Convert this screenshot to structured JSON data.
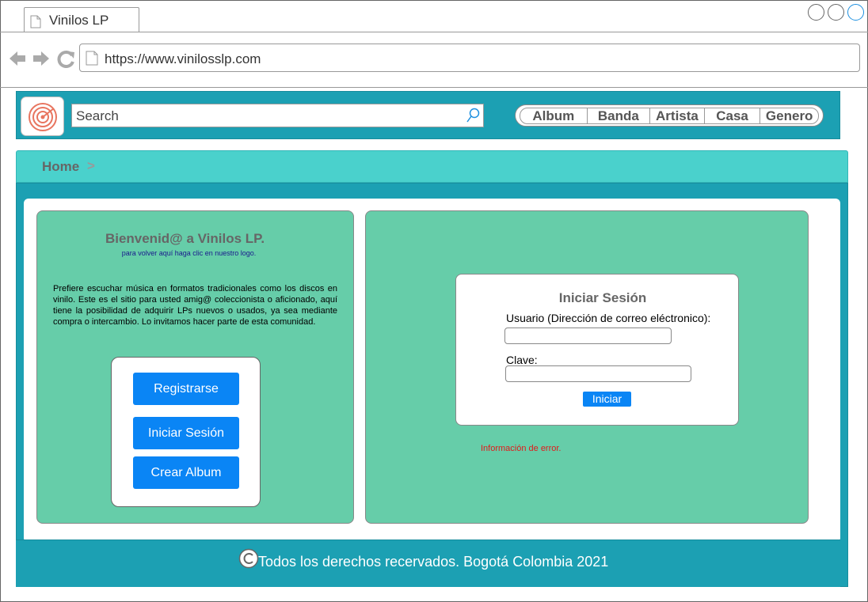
{
  "browser": {
    "tab_title": "Vinilos LP",
    "url": "https://www.vinilosslp.com"
  },
  "header": {
    "search_placeholder": "Search",
    "nav": [
      "Album",
      "Banda",
      "Artista",
      "Casa",
      "Genero"
    ]
  },
  "breadcrumb": {
    "home": "Home",
    "separator": ">"
  },
  "welcome": {
    "title": "Bienvenid@ a Vinilos LP.",
    "subtitle": "para volver aquí haga clic en nuestro logo.",
    "paragraph": "Prefiere escuchar música en formatos tradicionales como los discos en vinilo. Este es el sitio para usted amig@ coleccionista o aficionado, aquí tiene la posibilidad de adquirir LPs nuevos o usados, ya sea mediante compra o intercambio. Lo invitamos hacer parte de esta comunidad."
  },
  "actions": {
    "register": "Registrarse",
    "login": "Iniciar Sesión",
    "create_album": "Crear Album"
  },
  "login": {
    "title": "Iniciar Sesión",
    "user_label": "Usuario (Dirección de correo eléctronico):",
    "password_label": "Clave:",
    "submit": "Iniciar",
    "error": "Información de error."
  },
  "footer": {
    "text": "Todos los derechos recervados. Bogotá Colombia 2021"
  },
  "colors": {
    "teal": "#1ca0b3",
    "breadcrumb": "#4ad1cc",
    "panel": "#66cda9",
    "button": "#0a85f5",
    "error": "#e01b1b"
  }
}
